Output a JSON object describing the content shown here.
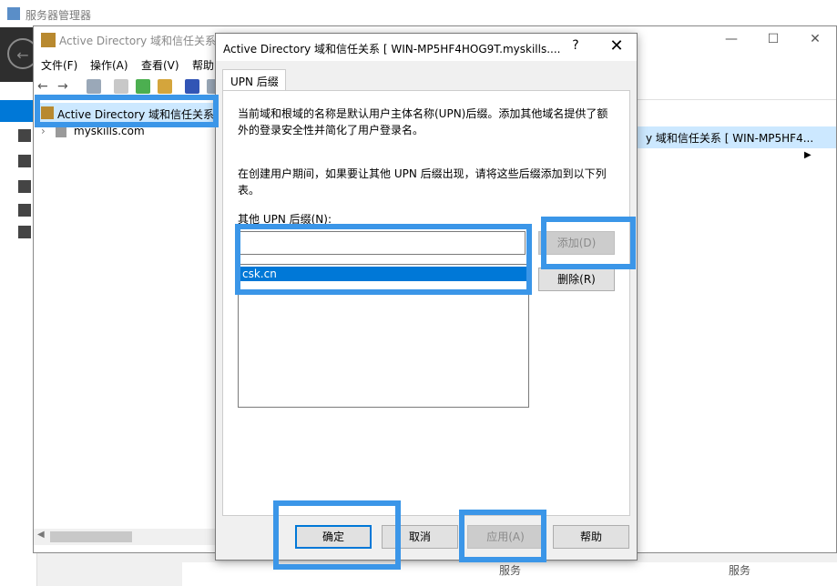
{
  "server_manager": {
    "title": "服务器管理器",
    "bottom_cells": [
      "服务",
      "服务"
    ]
  },
  "ad_window": {
    "title": "Active Directory 域和信任关系",
    "menu": [
      "文件(F)",
      "操作(A)",
      "查看(V)",
      "帮助"
    ],
    "tree": {
      "root": "Active Directory 域和信任关系",
      "child": "myskills.com"
    },
    "right_selected": "y 域和信任关系 [ WIN-MP5HF4..."
  },
  "dialog": {
    "title": "Active Directory 域和信任关系 [ WIN-MP5HF4HOG9T.myskills....",
    "help_glyph": "?",
    "tab_label": "UPN 后缀",
    "desc1_line1": "当前域和根域的名称是默认用户主体名称(UPN)后缀。添加其他域名提供了额",
    "desc1_line2": "外的登录安全性并简化了用户登录名。",
    "desc2_line1": "在创建用户期间，如果要让其他 UPN 后缀出现，请将这些后缀添加到以下列",
    "desc2_line2": "表。",
    "suffix_label": "其他 UPN 后缀(N):",
    "suffix_input_value": "",
    "suffix_items": [
      "csk.cn"
    ],
    "add_button": "添加(D)",
    "remove_button": "删除(R)",
    "ok_button": "确定",
    "cancel_button": "取消",
    "apply_button": "应用(A)",
    "help_button": "帮助"
  },
  "colors": {
    "highlight": "#3b96e8",
    "selection": "#0078d7"
  }
}
